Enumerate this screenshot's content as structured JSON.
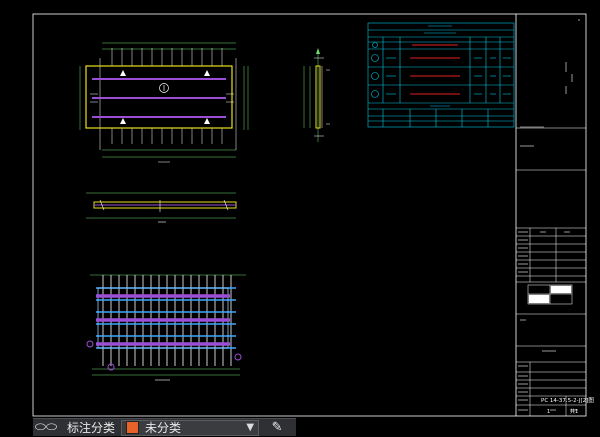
{
  "drawing": {
    "colors": {
      "background": "#000000",
      "frame": "#ffffff",
      "slab": "#e8e01e",
      "rebar": "#ffffff",
      "strand": "#9a4fd6",
      "table": "#00c8e6",
      "table_red": "#e02020",
      "dim": "#6ee06e",
      "mesh": "#3ea8ff"
    },
    "title_block": {
      "drawing_code": "PC 14-37.5-2-J[2]图",
      "sheet_no": "1",
      "total_sheets": "共1"
    }
  },
  "bottom_bar": {
    "layers_icon": "layers-icon",
    "layer_label": "标注分类",
    "layer_value": "未分类",
    "layer_color": "#e8622a",
    "dropdown_icon": "chevron-down-icon",
    "match_icon": "layer-match-icon"
  }
}
